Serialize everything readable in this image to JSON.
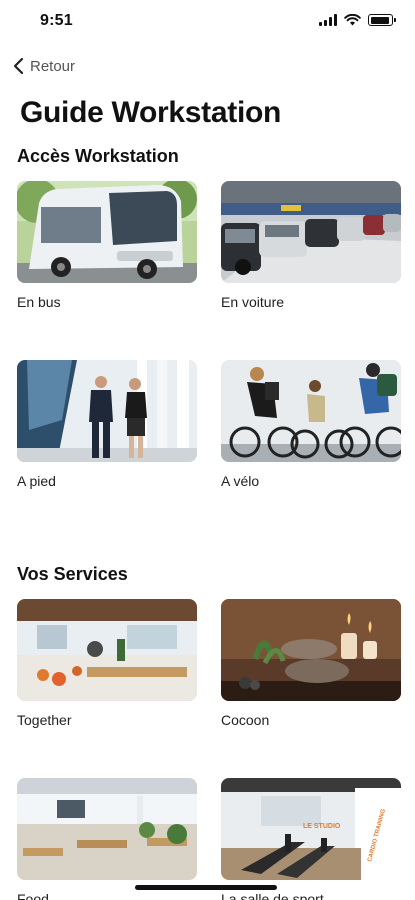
{
  "status": {
    "time": "9:51",
    "battery_level": 0.9
  },
  "nav": {
    "back_label": "Retour"
  },
  "page": {
    "title": "Guide Workstation"
  },
  "sections": [
    {
      "title": "Accès Workstation",
      "items": [
        {
          "label": "En bus",
          "image": "bus-photo"
        },
        {
          "label": "En voiture",
          "image": "parking-photo"
        },
        {
          "label": "A pied",
          "image": "walking-photo"
        },
        {
          "label": "A vélo",
          "image": "cycling-photo"
        }
      ]
    },
    {
      "title": "Vos Services",
      "items": [
        {
          "label": "Together",
          "image": "together-photo"
        },
        {
          "label": "Cocoon",
          "image": "spa-photo"
        },
        {
          "label": "Food",
          "image": "food-hall-photo"
        },
        {
          "label": "La salle de sport",
          "image": "gym-photo"
        }
      ]
    }
  ],
  "images": {
    "gym_sign_1": "LE STUDIO",
    "gym_sign_2": "CARDIO TRAINING"
  },
  "colors": {
    "accent_orange": "#e07a2e",
    "text": "#111111",
    "muted": "#555555"
  }
}
